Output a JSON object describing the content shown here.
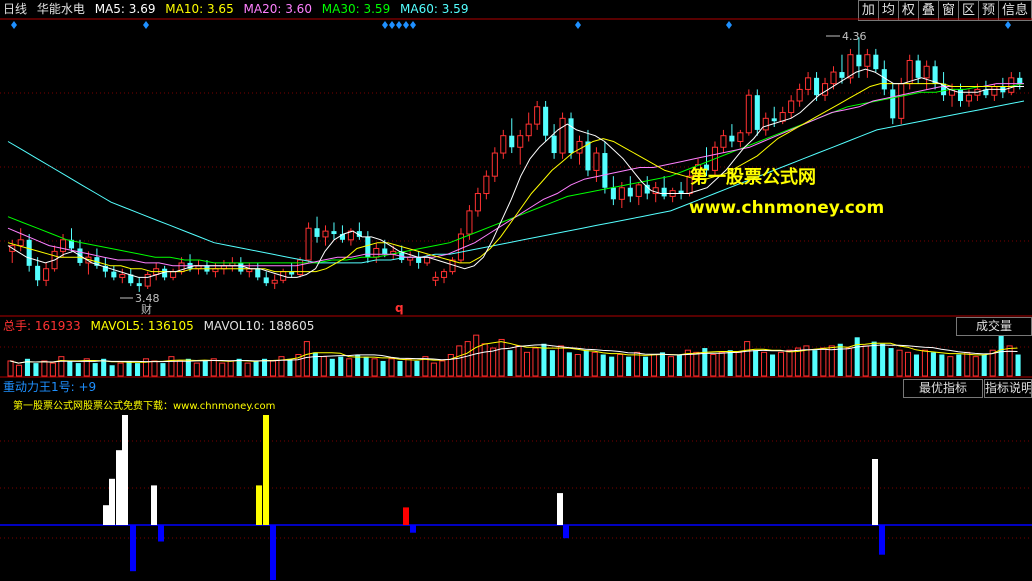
{
  "colors": {
    "up": "#ff3232",
    "down": "#54ffff",
    "ma5": "#ffffff",
    "ma10": "#ffff00",
    "ma20": "#ff80ff",
    "ma30": "#00ff00",
    "ma60": "#54ffff",
    "dot": "#1e90ff",
    "panel_border": "#b00000",
    "zero_line": "#0000ff",
    "watermark": "#ffff00"
  },
  "header": {
    "period": "日线",
    "stock_name": "华能水电",
    "ma5": "MA5: 3.69",
    "ma10": "MA10: 3.65",
    "ma20": "MA20: 3.60",
    "ma30": "MA30: 3.59",
    "ma60": "MA60: 3.59"
  },
  "toolbar": [
    "加",
    "均",
    "权",
    "叠",
    "窗",
    "区",
    "预",
    "信息"
  ],
  "price_panel": {
    "high_label": "4.36",
    "low_label": "3.48",
    "cai_marker": "财",
    "q_marker": "q",
    "watermark_cn": "第一股票公式网",
    "watermark_url": "www.chnmoney.com"
  },
  "volume_panel": {
    "total": "总手: 161933",
    "mavol5": "MAVOL5: 136105",
    "mavol10": "MAVOL10: 188605",
    "button": "成交量"
  },
  "indicator_panel": {
    "name": "重动力王1号: +9",
    "best_button": "最优指标",
    "explain_button": "指标说明",
    "note": "第一股票公式网股票公式免费下载：www.chnmoney.com"
  },
  "chart_data": {
    "type": "candlestick",
    "ylim": [
      3.4,
      4.42
    ],
    "high": 4.36,
    "low": 3.48,
    "candles": [
      [
        3.62,
        3.66,
        3.58,
        3.64
      ],
      [
        3.64,
        3.7,
        3.62,
        3.66
      ],
      [
        3.66,
        3.68,
        3.55,
        3.57
      ],
      [
        3.57,
        3.6,
        3.5,
        3.52
      ],
      [
        3.52,
        3.58,
        3.5,
        3.56
      ],
      [
        3.56,
        3.64,
        3.55,
        3.62
      ],
      [
        3.62,
        3.68,
        3.6,
        3.66
      ],
      [
        3.66,
        3.7,
        3.62,
        3.63
      ],
      [
        3.63,
        3.66,
        3.57,
        3.58
      ],
      [
        3.58,
        3.62,
        3.54,
        3.6
      ],
      [
        3.6,
        3.63,
        3.56,
        3.57
      ],
      [
        3.57,
        3.6,
        3.53,
        3.55
      ],
      [
        3.55,
        3.57,
        3.52,
        3.53
      ],
      [
        3.53,
        3.56,
        3.51,
        3.54
      ],
      [
        3.54,
        3.56,
        3.5,
        3.51
      ],
      [
        3.51,
        3.53,
        3.48,
        3.5
      ],
      [
        3.5,
        3.55,
        3.49,
        3.54
      ],
      [
        3.54,
        3.58,
        3.52,
        3.56
      ],
      [
        3.56,
        3.57,
        3.52,
        3.53
      ],
      [
        3.53,
        3.56,
        3.52,
        3.55
      ],
      [
        3.55,
        3.6,
        3.54,
        3.58
      ],
      [
        3.58,
        3.61,
        3.55,
        3.56
      ],
      [
        3.56,
        3.59,
        3.54,
        3.57
      ],
      [
        3.57,
        3.59,
        3.54,
        3.55
      ],
      [
        3.55,
        3.58,
        3.53,
        3.56
      ],
      [
        3.56,
        3.59,
        3.54,
        3.57
      ],
      [
        3.57,
        3.6,
        3.55,
        3.58
      ],
      [
        3.58,
        3.6,
        3.54,
        3.55
      ],
      [
        3.55,
        3.58,
        3.53,
        3.56
      ],
      [
        3.56,
        3.58,
        3.52,
        3.53
      ],
      [
        3.53,
        3.55,
        3.5,
        3.51
      ],
      [
        3.51,
        3.54,
        3.49,
        3.52
      ],
      [
        3.52,
        3.56,
        3.51,
        3.55
      ],
      [
        3.55,
        3.58,
        3.53,
        3.54
      ],
      [
        3.54,
        3.6,
        3.53,
        3.59
      ],
      [
        3.59,
        3.72,
        3.58,
        3.7
      ],
      [
        3.7,
        3.74,
        3.65,
        3.67
      ],
      [
        3.67,
        3.71,
        3.64,
        3.69
      ],
      [
        3.69,
        3.72,
        3.66,
        3.68
      ],
      [
        3.68,
        3.71,
        3.65,
        3.66
      ],
      [
        3.66,
        3.7,
        3.64,
        3.69
      ],
      [
        3.69,
        3.72,
        3.66,
        3.67
      ],
      [
        3.67,
        3.69,
        3.58,
        3.6
      ],
      [
        3.6,
        3.65,
        3.58,
        3.63
      ],
      [
        3.63,
        3.66,
        3.6,
        3.61
      ],
      [
        3.61,
        3.64,
        3.59,
        3.62
      ],
      [
        3.62,
        3.64,
        3.58,
        3.59
      ],
      [
        3.59,
        3.62,
        3.57,
        3.6
      ],
      [
        3.6,
        3.62,
        3.56,
        3.58
      ],
      [
        3.58,
        3.61,
        3.57,
        3.6
      ],
      [
        3.52,
        3.55,
        3.5,
        3.53
      ],
      [
        3.53,
        3.56,
        3.51,
        3.55
      ],
      [
        3.55,
        3.6,
        3.54,
        3.59
      ],
      [
        3.59,
        3.7,
        3.58,
        3.68
      ],
      [
        3.68,
        3.78,
        3.66,
        3.76
      ],
      [
        3.76,
        3.84,
        3.74,
        3.82
      ],
      [
        3.82,
        3.9,
        3.8,
        3.88
      ],
      [
        3.88,
        3.98,
        3.86,
        3.96
      ],
      [
        3.96,
        4.04,
        3.94,
        4.02
      ],
      [
        4.02,
        4.08,
        3.96,
        3.98
      ],
      [
        3.98,
        4.04,
        3.92,
        4.02
      ],
      [
        4.02,
        4.1,
        4.0,
        4.06
      ],
      [
        4.06,
        4.14,
        4.04,
        4.12
      ],
      [
        4.12,
        4.14,
        4.0,
        4.02
      ],
      [
        4.02,
        4.06,
        3.94,
        3.96
      ],
      [
        3.96,
        4.1,
        3.94,
        4.08
      ],
      [
        4.08,
        4.1,
        3.94,
        3.96
      ],
      [
        3.96,
        4.02,
        3.92,
        4.0
      ],
      [
        4.0,
        4.04,
        3.88,
        3.9
      ],
      [
        3.9,
        3.98,
        3.86,
        3.96
      ],
      [
        3.96,
        4.0,
        3.82,
        3.84
      ],
      [
        3.84,
        3.88,
        3.78,
        3.8
      ],
      [
        3.8,
        3.86,
        3.77,
        3.84
      ],
      [
        3.84,
        3.88,
        3.79,
        3.81
      ],
      [
        3.81,
        3.86,
        3.78,
        3.85
      ],
      [
        3.85,
        3.88,
        3.8,
        3.82
      ],
      [
        3.82,
        3.86,
        3.79,
        3.84
      ],
      [
        3.84,
        3.88,
        3.8,
        3.81
      ],
      [
        3.81,
        3.84,
        3.79,
        3.83
      ],
      [
        3.83,
        3.86,
        3.8,
        3.82
      ],
      [
        3.82,
        3.9,
        3.81,
        3.88
      ],
      [
        3.88,
        3.94,
        3.86,
        3.92
      ],
      [
        3.92,
        3.98,
        3.88,
        3.9
      ],
      [
        3.9,
        4.0,
        3.88,
        3.98
      ],
      [
        3.98,
        4.04,
        3.96,
        4.02
      ],
      [
        4.02,
        4.06,
        3.98,
        4.0
      ],
      [
        4.0,
        4.04,
        3.98,
        4.03
      ],
      [
        4.03,
        4.18,
        4.02,
        4.16
      ],
      [
        4.16,
        4.18,
        4.02,
        4.04
      ],
      [
        4.04,
        4.1,
        4.02,
        4.08
      ],
      [
        4.08,
        4.12,
        4.05,
        4.07
      ],
      [
        4.07,
        4.12,
        4.06,
        4.1
      ],
      [
        4.1,
        4.16,
        4.08,
        4.14
      ],
      [
        4.14,
        4.2,
        4.12,
        4.18
      ],
      [
        4.18,
        4.24,
        4.16,
        4.22
      ],
      [
        4.22,
        4.24,
        4.14,
        4.16
      ],
      [
        4.16,
        4.22,
        4.14,
        4.2
      ],
      [
        4.2,
        4.26,
        4.18,
        4.24
      ],
      [
        4.24,
        4.3,
        4.2,
        4.22
      ],
      [
        4.22,
        4.32,
        4.2,
        4.3
      ],
      [
        4.3,
        4.36,
        4.22,
        4.26
      ],
      [
        4.26,
        4.32,
        4.22,
        4.3
      ],
      [
        4.3,
        4.32,
        4.24,
        4.25
      ],
      [
        4.25,
        4.28,
        4.16,
        4.18
      ],
      [
        4.18,
        4.2,
        4.06,
        4.08
      ],
      [
        4.08,
        4.22,
        4.06,
        4.2
      ],
      [
        4.2,
        4.3,
        4.18,
        4.28
      ],
      [
        4.28,
        4.3,
        4.2,
        4.22
      ],
      [
        4.22,
        4.28,
        4.18,
        4.26
      ],
      [
        4.26,
        4.28,
        4.18,
        4.2
      ],
      [
        4.2,
        4.24,
        4.14,
        4.16
      ],
      [
        4.16,
        4.2,
        4.12,
        4.18
      ],
      [
        4.18,
        4.2,
        4.12,
        4.14
      ],
      [
        4.14,
        4.18,
        4.12,
        4.16
      ],
      [
        4.16,
        4.2,
        4.14,
        4.18
      ],
      [
        4.18,
        4.21,
        4.15,
        4.16
      ],
      [
        4.16,
        4.2,
        4.14,
        4.19
      ],
      [
        4.19,
        4.22,
        4.15,
        4.17
      ],
      [
        4.17,
        4.24,
        4.16,
        4.22
      ],
      [
        4.22,
        4.24,
        4.18,
        4.2
      ]
    ],
    "ma_lines": {
      "ma5": [
        3.64,
        3.62,
        3.6,
        3.59,
        3.58,
        3.59,
        3.61,
        3.62,
        3.6,
        3.58,
        3.57,
        3.56,
        3.55,
        3.54,
        3.53,
        3.53,
        3.54,
        3.55,
        3.55,
        3.56,
        3.57,
        3.57,
        3.57,
        3.57,
        3.57,
        3.57,
        3.56,
        3.56,
        3.55,
        3.54,
        3.53,
        3.53,
        3.54,
        3.56,
        3.62,
        3.66,
        3.68,
        3.69,
        3.67,
        3.67,
        3.66,
        3.64,
        3.62,
        3.61,
        3.6,
        3.6,
        3.59,
        3.58,
        3.57,
        3.56,
        3.57,
        3.6,
        3.66,
        3.73,
        3.8,
        3.88,
        3.94,
        3.98,
        4.01,
        4.04,
        4.06,
        4.04,
        4.03,
        4.02,
        4.0,
        3.97,
        3.94,
        3.9,
        3.86,
        3.83,
        3.82,
        3.82,
        3.82,
        3.82,
        3.83,
        3.84,
        3.87,
        3.9,
        3.94,
        3.98,
        4.01,
        4.05,
        4.06,
        4.07,
        4.08,
        4.1,
        4.13,
        4.16,
        4.18,
        4.2,
        4.22,
        4.24,
        4.25,
        4.24,
        4.22,
        4.2,
        4.2,
        4.21,
        4.22,
        4.21,
        4.2,
        4.18,
        4.17,
        4.17,
        4.17,
        4.18,
        4.18,
        4.18,
        4.19,
        4.19
      ],
      "ma10": [
        3.65,
        3.64,
        3.63,
        3.62,
        3.61,
        3.6,
        3.6,
        3.6,
        3.59,
        3.58,
        3.57,
        3.57,
        3.56,
        3.56,
        3.55,
        3.55,
        3.55,
        3.55,
        3.56,
        3.56,
        3.56,
        3.56,
        3.56,
        3.56,
        3.56,
        3.56,
        3.55,
        3.55,
        3.55,
        3.55,
        3.55,
        3.56,
        3.58,
        3.6,
        3.63,
        3.64,
        3.65,
        3.65,
        3.64,
        3.63,
        3.62,
        3.61,
        3.6,
        3.59,
        3.58,
        3.58,
        3.6,
        3.63,
        3.67,
        3.72,
        3.77,
        3.82,
        3.86,
        3.9,
        3.93,
        3.96,
        3.98,
        4.0,
        4.01,
        4.0,
        3.98,
        3.96,
        3.94,
        3.92,
        3.9,
        3.89,
        3.88,
        3.87,
        3.87,
        3.88,
        3.89,
        3.91,
        3.93,
        3.95,
        3.98,
        4.01,
        4.03,
        4.05,
        4.07,
        4.09,
        4.11,
        4.13,
        4.15,
        4.17,
        4.19,
        4.2,
        4.2,
        4.2,
        4.2,
        4.2,
        4.2,
        4.2,
        4.19,
        4.19,
        4.19,
        4.19,
        4.19,
        4.19,
        4.19,
        4.19
      ],
      "ma20": [
        3.7,
        3.68,
        3.66,
        3.64,
        3.63,
        3.62,
        3.61,
        3.6,
        3.59,
        3.59,
        3.58,
        3.58,
        3.57,
        3.57,
        3.57,
        3.57,
        3.57,
        3.57,
        3.57,
        3.57,
        3.57,
        3.57,
        3.58,
        3.59,
        3.6,
        3.6,
        3.61,
        3.61,
        3.61,
        3.6,
        3.6,
        3.6,
        3.61,
        3.63,
        3.65,
        3.68,
        3.71,
        3.74,
        3.77,
        3.8,
        3.82,
        3.85,
        3.87,
        3.88,
        3.89,
        3.9,
        3.91,
        3.91,
        3.92,
        3.93,
        3.94,
        3.95,
        3.96,
        3.97,
        3.98,
        4.0,
        4.02,
        4.04,
        4.06,
        4.08,
        4.1,
        4.11,
        4.12,
        4.14,
        4.15,
        4.16,
        4.17,
        4.18,
        4.19,
        4.19,
        4.19,
        4.19,
        4.2,
        4.2,
        4.2
      ],
      "ma30": [
        3.74,
        3.72,
        3.7,
        3.68,
        3.66,
        3.65,
        3.64,
        3.63,
        3.62,
        3.61,
        3.6,
        3.6,
        3.59,
        3.59,
        3.58,
        3.58,
        3.58,
        3.58,
        3.58,
        3.58,
        3.58,
        3.58,
        3.59,
        3.59,
        3.6,
        3.6,
        3.61,
        3.62,
        3.63,
        3.64,
        3.65,
        3.67,
        3.69,
        3.71,
        3.73,
        3.75,
        3.77,
        3.79,
        3.81,
        3.82,
        3.83,
        3.84,
        3.85,
        3.86,
        3.87,
        3.88,
        3.9,
        3.92,
        3.94,
        3.96,
        3.98,
        4.0,
        4.02,
        4.04,
        4.06,
        4.08,
        4.1,
        4.12,
        4.13,
        4.14,
        4.15,
        4.16,
        4.17,
        4.17,
        4.18,
        4.18,
        4.19,
        4.19,
        4.19,
        4.2
      ],
      "ma60": [
        4.0,
        3.97,
        3.94,
        3.91,
        3.88,
        3.85,
        3.82,
        3.79,
        3.77,
        3.75,
        3.73,
        3.71,
        3.69,
        3.67,
        3.65,
        3.64,
        3.63,
        3.62,
        3.61,
        3.6,
        3.59,
        3.58,
        3.58,
        3.58,
        3.58,
        3.59,
        3.59,
        3.6,
        3.6,
        3.61,
        3.61,
        3.62,
        3.63,
        3.64,
        3.65,
        3.66,
        3.67,
        3.68,
        3.69,
        3.7,
        3.71,
        3.72,
        3.73,
        3.74,
        3.75,
        3.76,
        3.78,
        3.8,
        3.82,
        3.84,
        3.86,
        3.88,
        3.9,
        3.92,
        3.94,
        3.96,
        3.98,
        4.0,
        4.02,
        4.04,
        4.05,
        4.06,
        4.07,
        4.08,
        4.09,
        4.1,
        4.11,
        4.12,
        4.13,
        4.14
      ]
    },
    "volume": [
      0.35,
      0.25,
      0.4,
      0.3,
      0.35,
      0.3,
      0.45,
      0.35,
      0.3,
      0.4,
      0.3,
      0.4,
      0.25,
      0.3,
      0.35,
      0.3,
      0.4,
      0.35,
      0.3,
      0.45,
      0.35,
      0.4,
      0.3,
      0.35,
      0.4,
      0.3,
      0.35,
      0.4,
      0.3,
      0.35,
      0.4,
      0.35,
      0.45,
      0.4,
      0.5,
      0.8,
      0.55,
      0.45,
      0.4,
      0.45,
      0.4,
      0.5,
      0.45,
      0.4,
      0.35,
      0.4,
      0.35,
      0.4,
      0.35,
      0.45,
      0.3,
      0.35,
      0.5,
      0.7,
      0.8,
      0.95,
      0.75,
      0.65,
      0.85,
      0.6,
      0.7,
      0.55,
      0.65,
      0.75,
      0.6,
      0.7,
      0.55,
      0.5,
      0.6,
      0.55,
      0.5,
      0.45,
      0.5,
      0.45,
      0.55,
      0.45,
      0.5,
      0.55,
      0.45,
      0.5,
      0.6,
      0.55,
      0.65,
      0.5,
      0.55,
      0.6,
      0.55,
      0.8,
      0.6,
      0.55,
      0.5,
      0.55,
      0.6,
      0.65,
      0.7,
      0.6,
      0.65,
      0.7,
      0.75,
      0.65,
      0.9,
      0.7,
      0.8,
      0.75,
      0.65,
      0.6,
      0.55,
      0.5,
      0.6,
      0.55,
      0.5,
      0.45,
      0.5,
      0.55,
      0.45,
      0.5,
      0.6,
      0.95,
      0.7,
      0.5
    ],
    "indicator_bars": [
      {
        "x": 103,
        "v": 0.18,
        "c": "#ffffff"
      },
      {
        "x": 109,
        "v": 0.42,
        "c": "#ffffff"
      },
      {
        "x": 116,
        "v": 0.68,
        "c": "#ffffff"
      },
      {
        "x": 122,
        "v": 1.0,
        "c": "#ffffff"
      },
      {
        "x": 130,
        "v": -0.42,
        "c": "#0000ff"
      },
      {
        "x": 151,
        "v": 0.36,
        "c": "#ffffff"
      },
      {
        "x": 158,
        "v": -0.15,
        "c": "#0000ff"
      },
      {
        "x": 256,
        "v": 0.36,
        "c": "#ffff00"
      },
      {
        "x": 263,
        "v": 1.0,
        "c": "#ffff00"
      },
      {
        "x": 270,
        "v": -0.5,
        "c": "#0000ff"
      },
      {
        "x": 403,
        "v": 0.16,
        "c": "#ff0000"
      },
      {
        "x": 410,
        "v": -0.07,
        "c": "#0000ff"
      },
      {
        "x": 557,
        "v": 0.29,
        "c": "#ffffff"
      },
      {
        "x": 563,
        "v": -0.12,
        "c": "#0000ff"
      },
      {
        "x": 872,
        "v": 0.6,
        "c": "#ffffff"
      },
      {
        "x": 879,
        "v": -0.27,
        "c": "#0000ff"
      }
    ]
  }
}
